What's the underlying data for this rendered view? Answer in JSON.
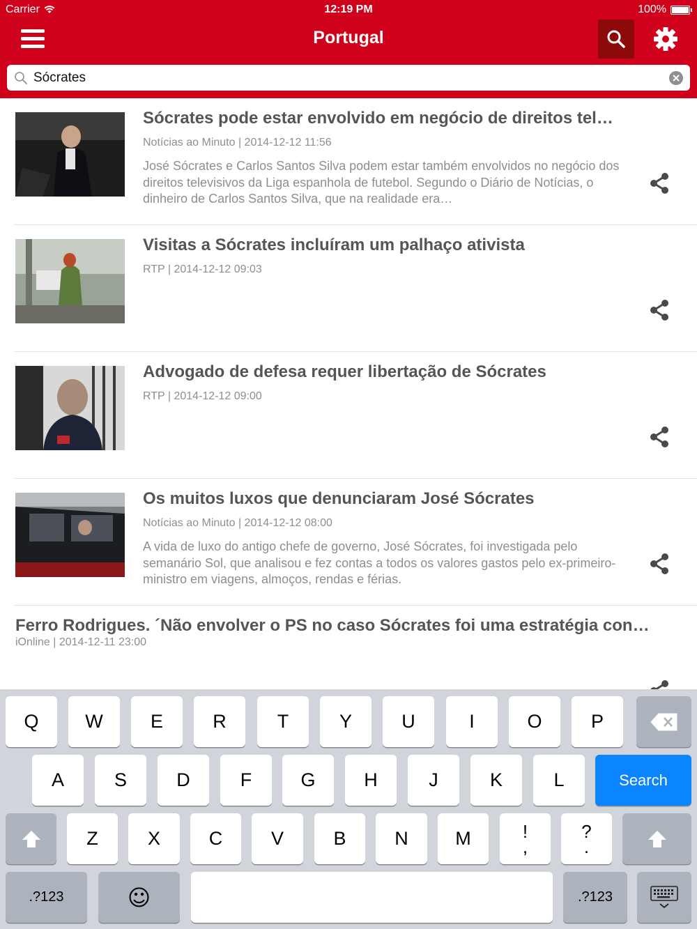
{
  "status_bar": {
    "carrier": "Carrier",
    "time": "12:19 PM",
    "battery": "100%"
  },
  "nav": {
    "title": "Portugal"
  },
  "search": {
    "value": "Sócrates"
  },
  "articles": [
    {
      "title": "Sócrates pode estar envolvido em negócio de direitos tel…",
      "meta": "Notícias ao Minuto | 2014-12-12 11:56",
      "description": "José Sócrates e Carlos Santos Silva podem estar também envolvidos no negócio dos direitos televisivos da Liga espanhola de futebol. Segundo o Diário de Notícias, o dinheiro de Carlos Santos Silva, que na realidade era…"
    },
    {
      "title": "Visitas a Sócrates incluíram um palhaço ativista",
      "meta": "RTP | 2014-12-12 09:03",
      "description": ""
    },
    {
      "title": "Advogado de defesa requer libertação de Sócrates",
      "meta": "RTP | 2014-12-12 09:00",
      "description": ""
    },
    {
      "title": "Os muitos luxos que denunciaram José Sócrates",
      "meta": "Notícias ao Minuto | 2014-12-12 08:00",
      "description": "A vida de luxo do antigo chefe de governo, José Sócrates, foi investigada pelo semanário Sol, que analisou e fez contas a todos os valores gastos pelo ex-primeiro-ministro em viagens, almoços, rendas e férias."
    },
    {
      "title": "Ferro Rodrigues. ´Não envolver o PS no caso Sócrates foi uma estratégia con…",
      "meta": "iOnline | 2014-12-11 23:00",
      "description": ""
    }
  ],
  "keyboard": {
    "row1": [
      "Q",
      "W",
      "E",
      "R",
      "T",
      "Y",
      "U",
      "I",
      "O",
      "P"
    ],
    "row2": [
      "A",
      "S",
      "D",
      "F",
      "G",
      "H",
      "J",
      "K",
      "L"
    ],
    "row3": [
      "Z",
      "X",
      "C",
      "V",
      "B",
      "N",
      "M"
    ],
    "punct1_top": "!",
    "punct1_bottom": ",",
    "punct2_top": "?",
    "punct2_bottom": ".",
    "search_label": "Search",
    "numbers_label": ".?123",
    "emoji": "☺"
  },
  "colors": {
    "brand_red": "#d0021b",
    "search_active": "#8e0a0a",
    "keyboard_blue": "#0a84ff"
  }
}
